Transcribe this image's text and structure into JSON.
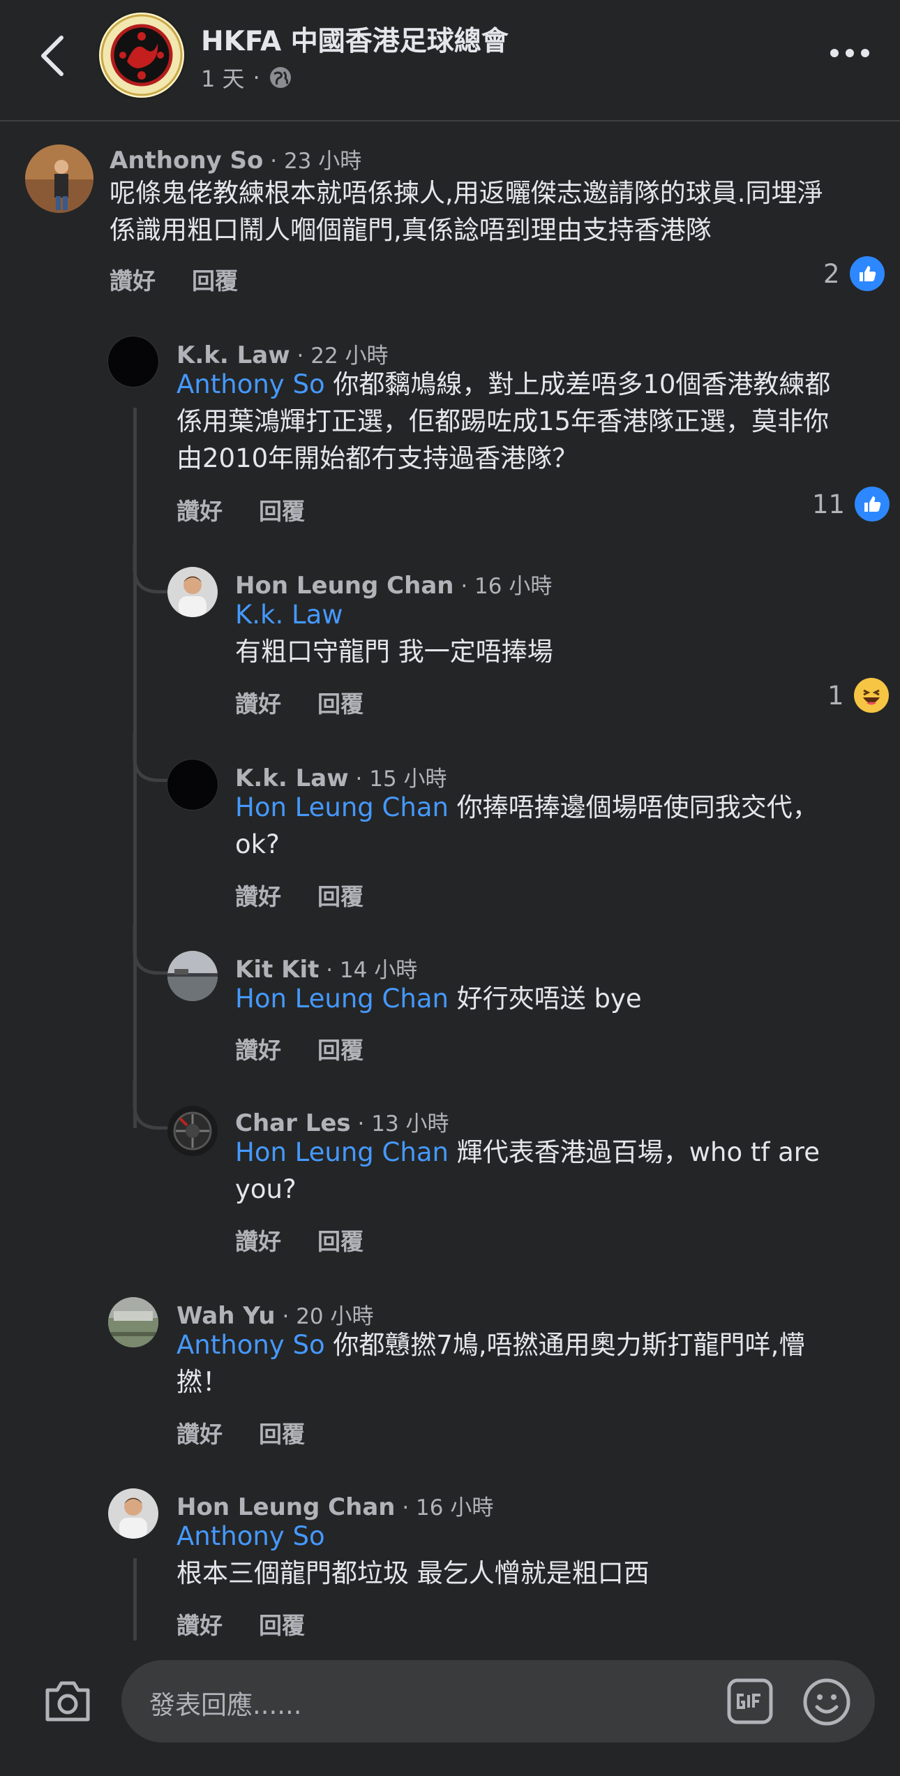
{
  "header": {
    "title": "HKFA 中國香港足球總會",
    "time": "1 天",
    "dot": "·"
  },
  "comments": [
    {
      "author": "Anthony So",
      "time": " · 23 小時",
      "text_lines": [
        "呢條鬼佬教練根本就唔係揀人,用返曬傑志邀請隊的球員.同埋淨",
        "係識用粗口鬧人嗰個龍門,真係諗唔到理由支持香港隊"
      ],
      "like": "讚好",
      "reply": "回覆",
      "reactions": "2"
    },
    {
      "author": "K.k. Law",
      "time": " · 22 小時",
      "mention": "Anthony So",
      "text_lines": [
        " 你都黐鳩線，對上成差唔多10個香港教練都",
        "係用葉鴻輝打正選，佢都踢咗成15年香港隊正選，莫非你",
        "由2010年開始都冇支持過香港隊？"
      ],
      "like": "讚好",
      "reply": "回覆",
      "reactions": "11"
    },
    {
      "author": "Hon Leung Chan",
      "time": " · 16 小時",
      "mention": "K.k. Law",
      "text_lines": [
        "有粗口守龍門  我一定唔捧場"
      ],
      "like": "讚好",
      "reply": "回覆",
      "reactions": "1"
    },
    {
      "author": "K.k. Law",
      "time": " · 15 小時",
      "mention": "Hon Leung Chan",
      "text_lines": [
        " 你捧唔捧邊個場唔使同我交代，",
        "ok?"
      ],
      "like": "讚好",
      "reply": "回覆"
    },
    {
      "author": "Kit Kit",
      "time": " · 14 小時",
      "mention": "Hon Leung Chan",
      "text_lines": [
        " 好行夾唔送 bye"
      ],
      "like": "讚好",
      "reply": "回覆"
    },
    {
      "author": "Char Les",
      "time": " · 13 小時",
      "mention": "Hon Leung Chan",
      "text_lines": [
        " 輝代表香港過百場，who tf are",
        "you?"
      ],
      "like": "讚好",
      "reply": "回覆"
    },
    {
      "author": "Wah Yu",
      "time": " · 20 小時",
      "mention": "Anthony So",
      "text_lines": [
        " 你都戇撚7鳩,唔撚通用奧力斯打龍門咩,懵",
        "撚！"
      ],
      "like": "讚好",
      "reply": "回覆"
    },
    {
      "author": "Hon Leung Chan",
      "time": " · 16 小時",
      "mention": "Anthony So",
      "text_lines": [
        "根本三個龍門都垃圾   最乞人憎就是粗口西"
      ],
      "like": "讚好",
      "reply": "回覆"
    }
  ],
  "composer": {
    "placeholder": "發表回應......"
  },
  "colors": {
    "background": "#242526",
    "mention": "#4599ff",
    "like_badge": "#2d88ff"
  }
}
